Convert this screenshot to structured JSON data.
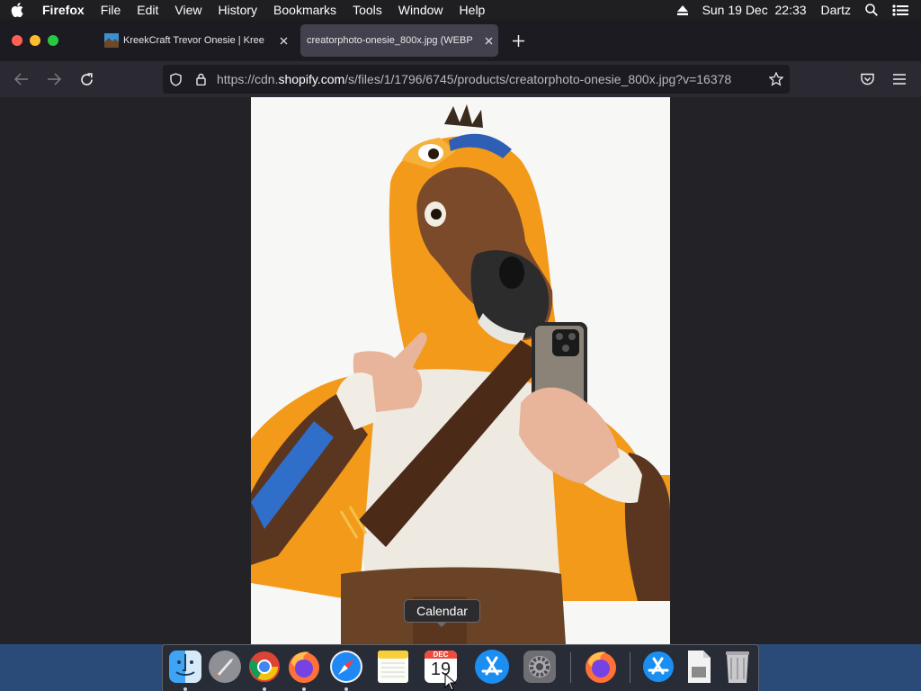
{
  "menubar": {
    "app_name": "Firefox",
    "items": [
      "File",
      "Edit",
      "View",
      "History",
      "Bookmarks",
      "Tools",
      "Window",
      "Help"
    ],
    "datetime": "Sun 19 Dec  22:33",
    "user": "Dartz"
  },
  "tabs": [
    {
      "title": "KreekCraft Trevor Onesie | Kree",
      "active": false
    },
    {
      "title": "creatorphoto-onesie_800x.jpg (WEBP",
      "active": true
    }
  ],
  "urlbar": {
    "prefix": "https://cdn.",
    "host": "shopify.com",
    "path": "/s/files/1/1796/6745/products/creatorphoto-onesie_800x.jpg?v=16378"
  },
  "tooltip": {
    "text": "Calendar"
  },
  "dock": {
    "calendar_month": "DEC",
    "calendar_day": "19",
    "items": [
      "finder-icon",
      "launchpad-icon",
      "chrome-icon",
      "firefox-icon",
      "safari-icon",
      "notes-icon",
      "calendar-icon",
      "app-store-icon",
      "system-preferences-icon",
      "firefox-icon",
      "app-store-icon",
      "preview-document-icon",
      "trash-icon"
    ]
  },
  "colors": {
    "menubar_bg": "#1f1f21",
    "tabbar_bg": "#1c1b22",
    "navbar_bg": "#2b2a33",
    "active_tab_bg": "#42414d",
    "desktop_bg": "#2a4a78",
    "onesie_orange": "#f39a1b"
  }
}
